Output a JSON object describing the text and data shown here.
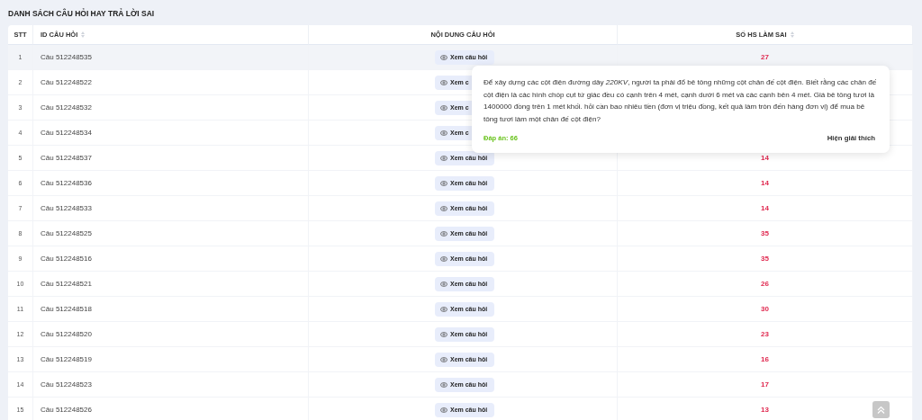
{
  "title": "DANH SÁCH CÂU HỎI HAY TRẢ LỜI SAI",
  "table": {
    "columns": [
      {
        "label": "STT",
        "sortable": false
      },
      {
        "label": "ID CÂU HỎI",
        "sortable": true
      },
      {
        "label": "NỘI DUNG CÂU HỎI",
        "sortable": false
      },
      {
        "label": "SỐ HS LÀM SAI",
        "sortable": true
      }
    ],
    "rows": [
      {
        "stt": "1",
        "id": "Câu 512248535",
        "action": "Xem câu hỏi",
        "wrong": "27",
        "hovered": true
      },
      {
        "stt": "2",
        "id": "Câu 512248522",
        "action": "Xem c",
        "hovered": false
      },
      {
        "stt": "3",
        "id": "Câu 512248532",
        "action": "Xem c",
        "hovered": false
      },
      {
        "stt": "4",
        "id": "Câu 512248534",
        "action": "Xem c",
        "hovered": false
      },
      {
        "stt": "5",
        "id": "Câu 512248537",
        "action": "Xem câu hỏi",
        "wrong": "14",
        "hovered": false
      },
      {
        "stt": "6",
        "id": "Câu 512248536",
        "action": "Xem câu hỏi",
        "wrong": "14",
        "hovered": false
      },
      {
        "stt": "7",
        "id": "Câu 512248533",
        "action": "Xem câu hỏi",
        "wrong": "14",
        "hovered": false
      },
      {
        "stt": "8",
        "id": "Câu 512248525",
        "action": "Xem câu hỏi",
        "wrong": "35",
        "hovered": false
      },
      {
        "stt": "9",
        "id": "Câu 512248516",
        "action": "Xem câu hỏi",
        "wrong": "35",
        "hovered": false
      },
      {
        "stt": "10",
        "id": "Câu 512248521",
        "action": "Xem câu hỏi",
        "wrong": "26",
        "hovered": false
      },
      {
        "stt": "11",
        "id": "Câu 512248518",
        "action": "Xem câu hỏi",
        "wrong": "30",
        "hovered": false
      },
      {
        "stt": "12",
        "id": "Câu 512248520",
        "action": "Xem câu hỏi",
        "wrong": "23",
        "hovered": false
      },
      {
        "stt": "13",
        "id": "Câu 512248519",
        "action": "Xem câu hỏi",
        "wrong": "16",
        "hovered": false
      },
      {
        "stt": "14",
        "id": "Câu 512248523",
        "action": "Xem câu hỏi",
        "wrong": "17",
        "hovered": false
      },
      {
        "stt": "15",
        "id": "Câu 512248526",
        "action": "Xem câu hỏi",
        "wrong": "13",
        "hovered": false
      }
    ]
  },
  "popover": {
    "question": "Để xây dựng các cột   điện đường dây *220KV*, người ta phải đổ bê tông những cột chân đế cột điện. Biết rằng các chân đế cột điện là các hình chóp cụt tứ giác đều có cạnh trên 4 mét, cạnh dưới 6 mét và các cạnh bên 4 mét. Giá bê tông tươi là 1400000 đồng trên 1 mét khối. hỏi cần bao nhiêu tiền (đơn vị triệu đồng, kết quả làm tròn đến hàng đơn vị) để mua bê tông tươi làm một chân đế cột điện?",
    "answer": "Đáp án: 66",
    "explain": "Hiện giải thích"
  }
}
